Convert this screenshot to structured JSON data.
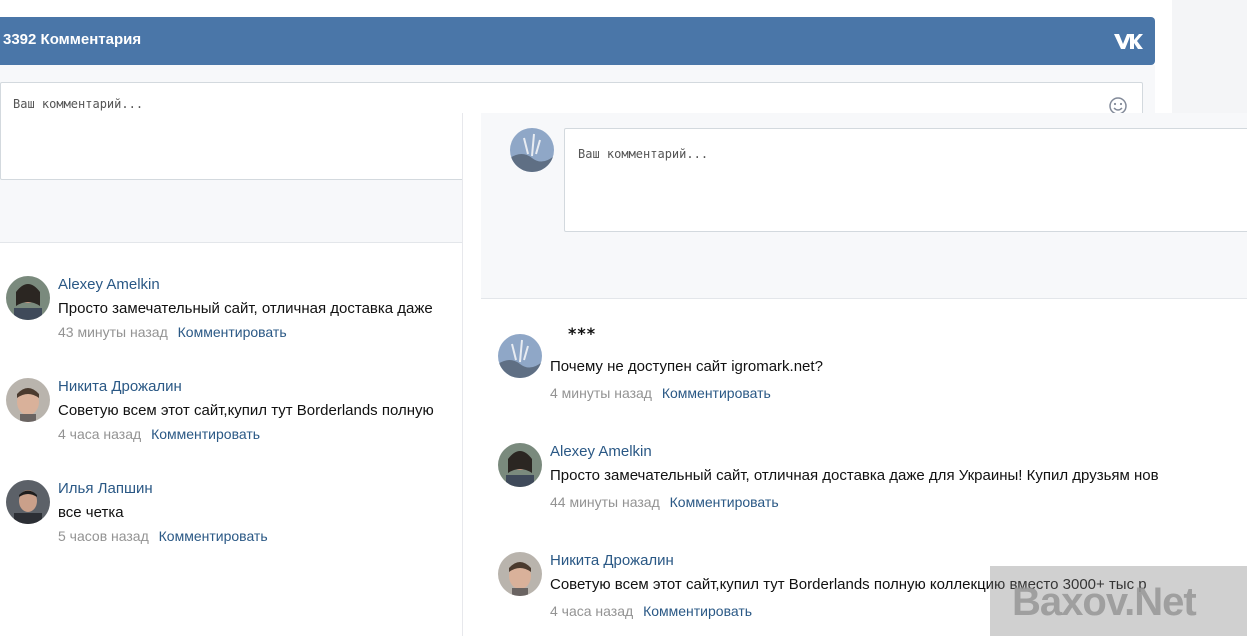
{
  "back": {
    "header_title": "3392 Комментария",
    "placeholder": "Ваш комментарий...",
    "comments": [
      {
        "author": "Alexey Amelkin",
        "text": "Просто замечательный сайт, отличная доставка даже",
        "time": "43 минуты назад",
        "reply": "Комментировать"
      },
      {
        "author": "Никита Дрожалин",
        "text": "Советую всем этот сайт,купил тут Borderlands полную",
        "time": "4 часа назад",
        "reply": "Комментировать"
      },
      {
        "author": "Илья Лапшин",
        "text": "все четка",
        "time": "5 часов назад",
        "reply": "Комментировать"
      }
    ]
  },
  "front": {
    "placeholder": "Ваш комментарий...",
    "comments": [
      {
        "author": "***",
        "text": "Почему не доступен сайт igromark.net?",
        "time": "4 минуты назад",
        "reply": "Комментировать"
      },
      {
        "author": "Alexey Amelkin",
        "text": "Просто замечательный сайт, отличная доставка даже для Украины! Купил друзьям нов",
        "time": "44 минуты назад",
        "reply": "Комментировать"
      },
      {
        "author": "Никита Дрожалин",
        "text": "Советую всем этот сайт,купил тут Borderlands полную коллекцию вместо 3000+ тыс р",
        "time": "4 часа назад",
        "reply": "Комментировать"
      }
    ]
  },
  "watermark": "Baxov.Net",
  "icons": {
    "logo": "vk-logo-icon",
    "smile": "smile-icon"
  },
  "colors": {
    "header": "#4a76a8",
    "link": "#2a5885",
    "muted": "#939393"
  }
}
